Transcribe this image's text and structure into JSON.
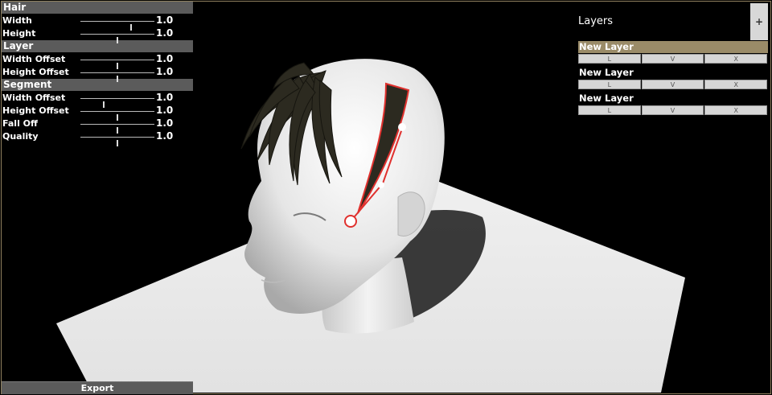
{
  "hair_section": {
    "title": "Hair",
    "rows": [
      {
        "label": "Width",
        "value": "1.0",
        "slider": 0.68
      },
      {
        "label": "Height",
        "value": "1.0",
        "slider": 0.5
      }
    ]
  },
  "layer_section": {
    "title": "Layer",
    "rows": [
      {
        "label": "Width Offset",
        "value": "1.0",
        "slider": 0.5
      },
      {
        "label": "Height Offset",
        "value": "1.0",
        "slider": 0.5
      }
    ]
  },
  "segment_section": {
    "title": "Segment",
    "rows": [
      {
        "label": "Width Offset",
        "value": "1.0",
        "slider": 0.32
      },
      {
        "label": "Height Offset",
        "value": "1.0",
        "slider": 0.5
      },
      {
        "label": "Fall Off",
        "value": "1.0",
        "slider": 0.5
      },
      {
        "label": "Quality",
        "value": "1.0",
        "slider": 0.5
      }
    ]
  },
  "export_label": "Export",
  "layers_panel": {
    "title": "Layers",
    "add_label": "+",
    "items": [
      {
        "name": "New Layer",
        "selected": true,
        "buttons": [
          "L",
          "V",
          "X"
        ]
      },
      {
        "name": "New Layer",
        "selected": false,
        "buttons": [
          "L",
          "V",
          "X"
        ]
      },
      {
        "name": "New Layer",
        "selected": false,
        "buttons": [
          "L",
          "V",
          "X"
        ]
      }
    ]
  },
  "colors": {
    "accent": "#9a8b68",
    "curve": "#e0312e",
    "panel": "#5b5b5b"
  }
}
